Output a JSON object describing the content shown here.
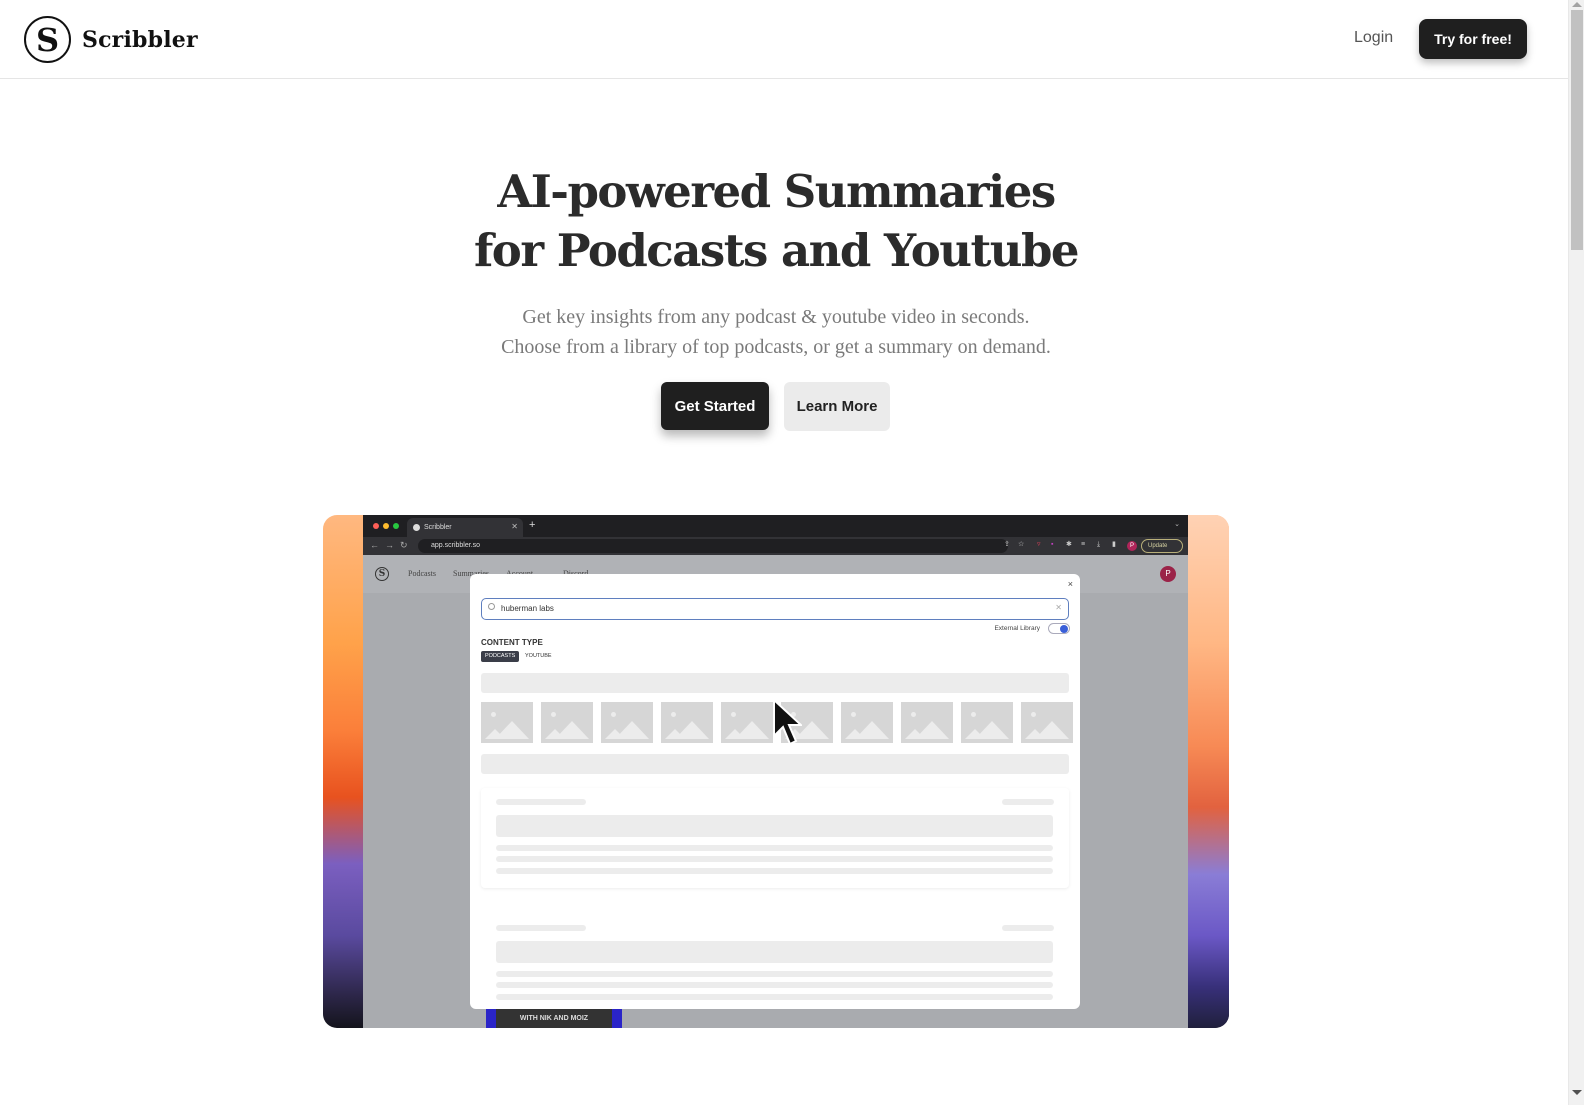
{
  "header": {
    "brand": "Scribbler",
    "logo_letter": "S",
    "login_label": "Login",
    "cta_label": "Try for free!"
  },
  "hero": {
    "title_line1": "AI-powered Summaries",
    "title_line2": "for Podcasts and Youtube",
    "subtitle_line1": "Get key insights from any podcast & youtube video in seconds.",
    "subtitle_line2": "Choose from a library of top podcasts, or get a summary on demand.",
    "primary_button": "Get Started",
    "secondary_button": "Learn More"
  },
  "demo": {
    "browser": {
      "tab_title": "Scribbler",
      "url": "app.scribbler.so",
      "update_label": "Update",
      "profile_initial": "P"
    },
    "app_nav": {
      "links": [
        "Podcasts",
        "Summaries",
        "Account",
        "Discord"
      ],
      "avatar_initial": "P"
    },
    "modal": {
      "close_glyph": "×",
      "search_value": "huberman labs",
      "external_library_label": "External Library",
      "external_library_on": true,
      "content_type_label": "CONTENT TYPE",
      "content_types": [
        "PODCASTS",
        "YOUTUBE"
      ],
      "selected_content_type": "PODCASTS",
      "thumbnail_count": 10
    },
    "podcast_peek_text": "WITH NIK AND MOIZ"
  },
  "colors": {
    "dark_button": "#1f1f1f",
    "secondary_button": "#ebebeb",
    "toggle_accent": "#3a5fd8"
  }
}
